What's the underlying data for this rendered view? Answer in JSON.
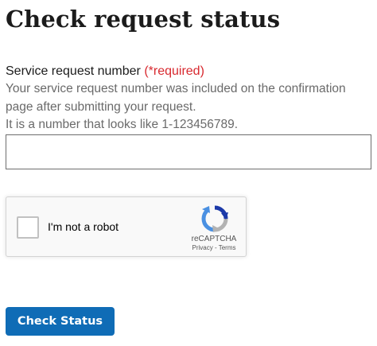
{
  "page": {
    "title": "Check request status"
  },
  "form": {
    "field_label": "Service request number",
    "required_label": "(*required)",
    "hint_lines": [
      "Your service request number was included on the confirmation",
      "page after submitting your request.",
      "It is a number that looks like 1-123456789."
    ],
    "input_value": "",
    "submit_label": "Check Status"
  },
  "recaptcha": {
    "checkbox_label": "I'm not a robot",
    "checked": false,
    "brand": "reCAPTCHA",
    "privacy_link": "Privacy",
    "separator": " - ",
    "terms_link": "Terms",
    "logo_icon": "recaptcha-logo-icon"
  },
  "colors": {
    "required": "#d8292f",
    "button_bg": "#0f6cb6",
    "hint_text": "#6a6a6a",
    "recaptcha_blue_dark": "#1c3aa9",
    "recaptcha_blue": "#4a90e2",
    "recaptcha_gray": "#b3b3b3"
  }
}
